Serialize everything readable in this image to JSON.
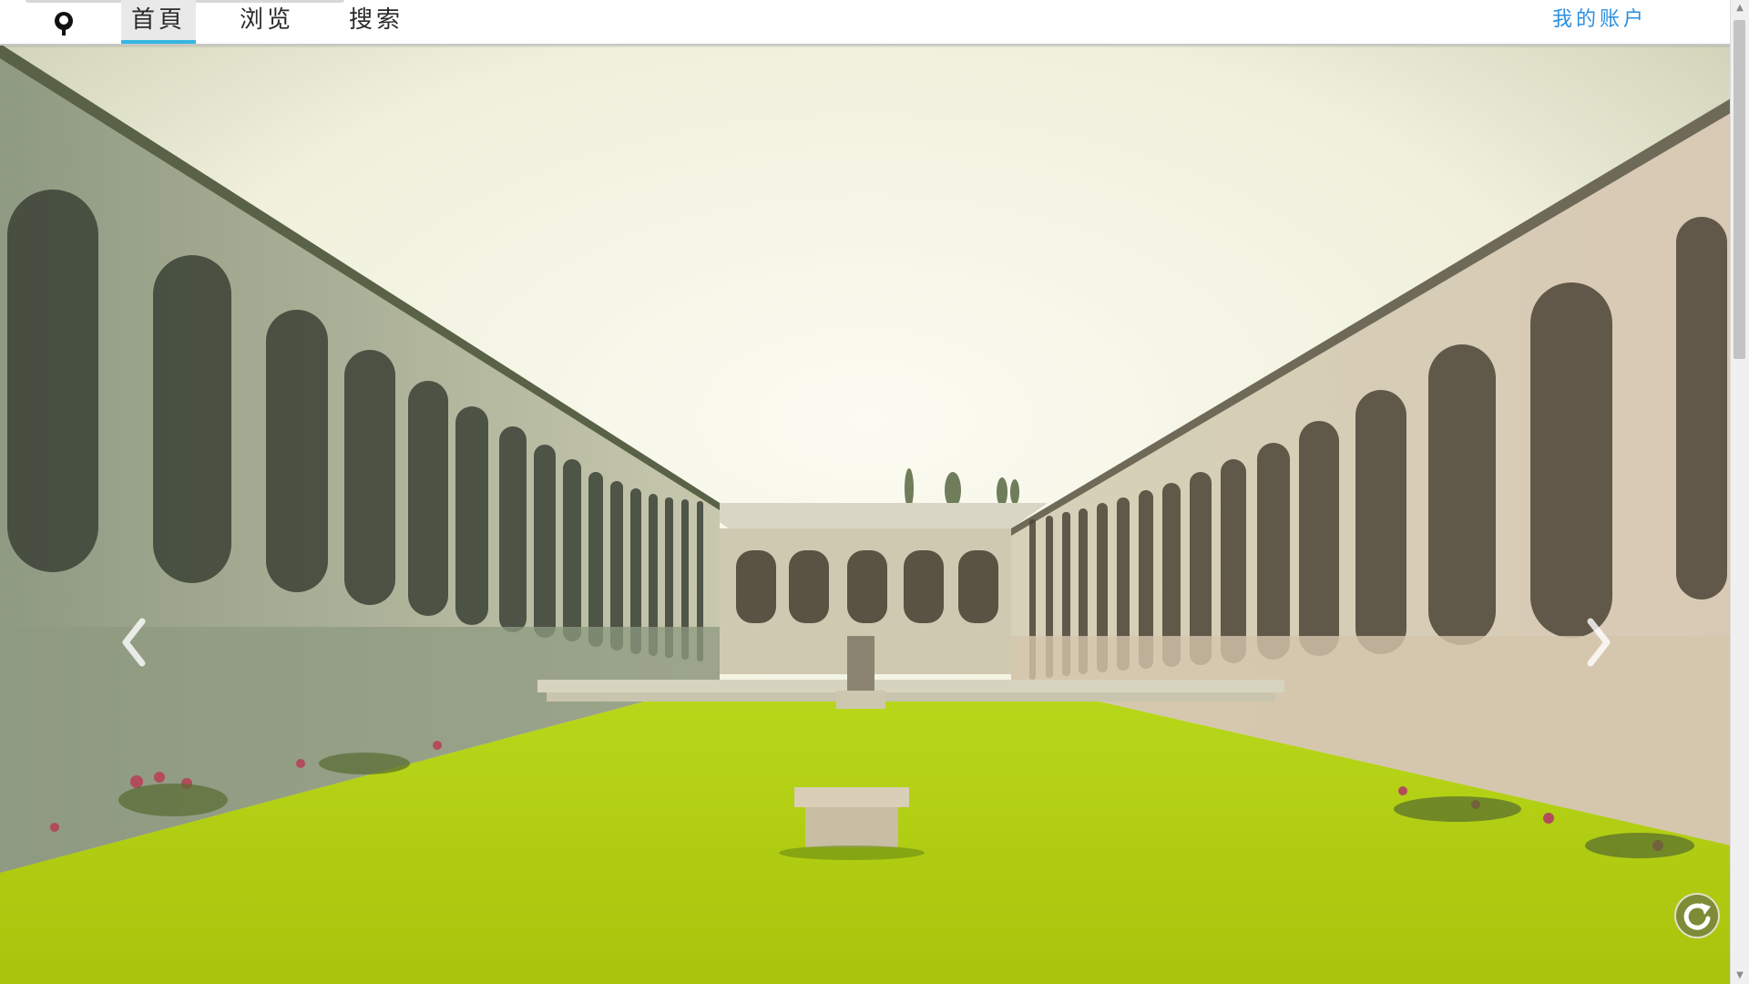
{
  "nav": {
    "logo_icon": "user-avatar-icon",
    "tabs": [
      {
        "label": "首頁",
        "active": true
      },
      {
        "label": "浏览",
        "active": false
      },
      {
        "label": "搜索",
        "active": false
      }
    ],
    "account_label": "我的账户",
    "accent_color": "#35b6e0",
    "account_color": "#2b8fe0"
  },
  "carousel": {
    "prev_icon": "chevron-left-icon",
    "next_icon": "chevron-right-icon",
    "refresh_icon": "refresh-icon"
  }
}
